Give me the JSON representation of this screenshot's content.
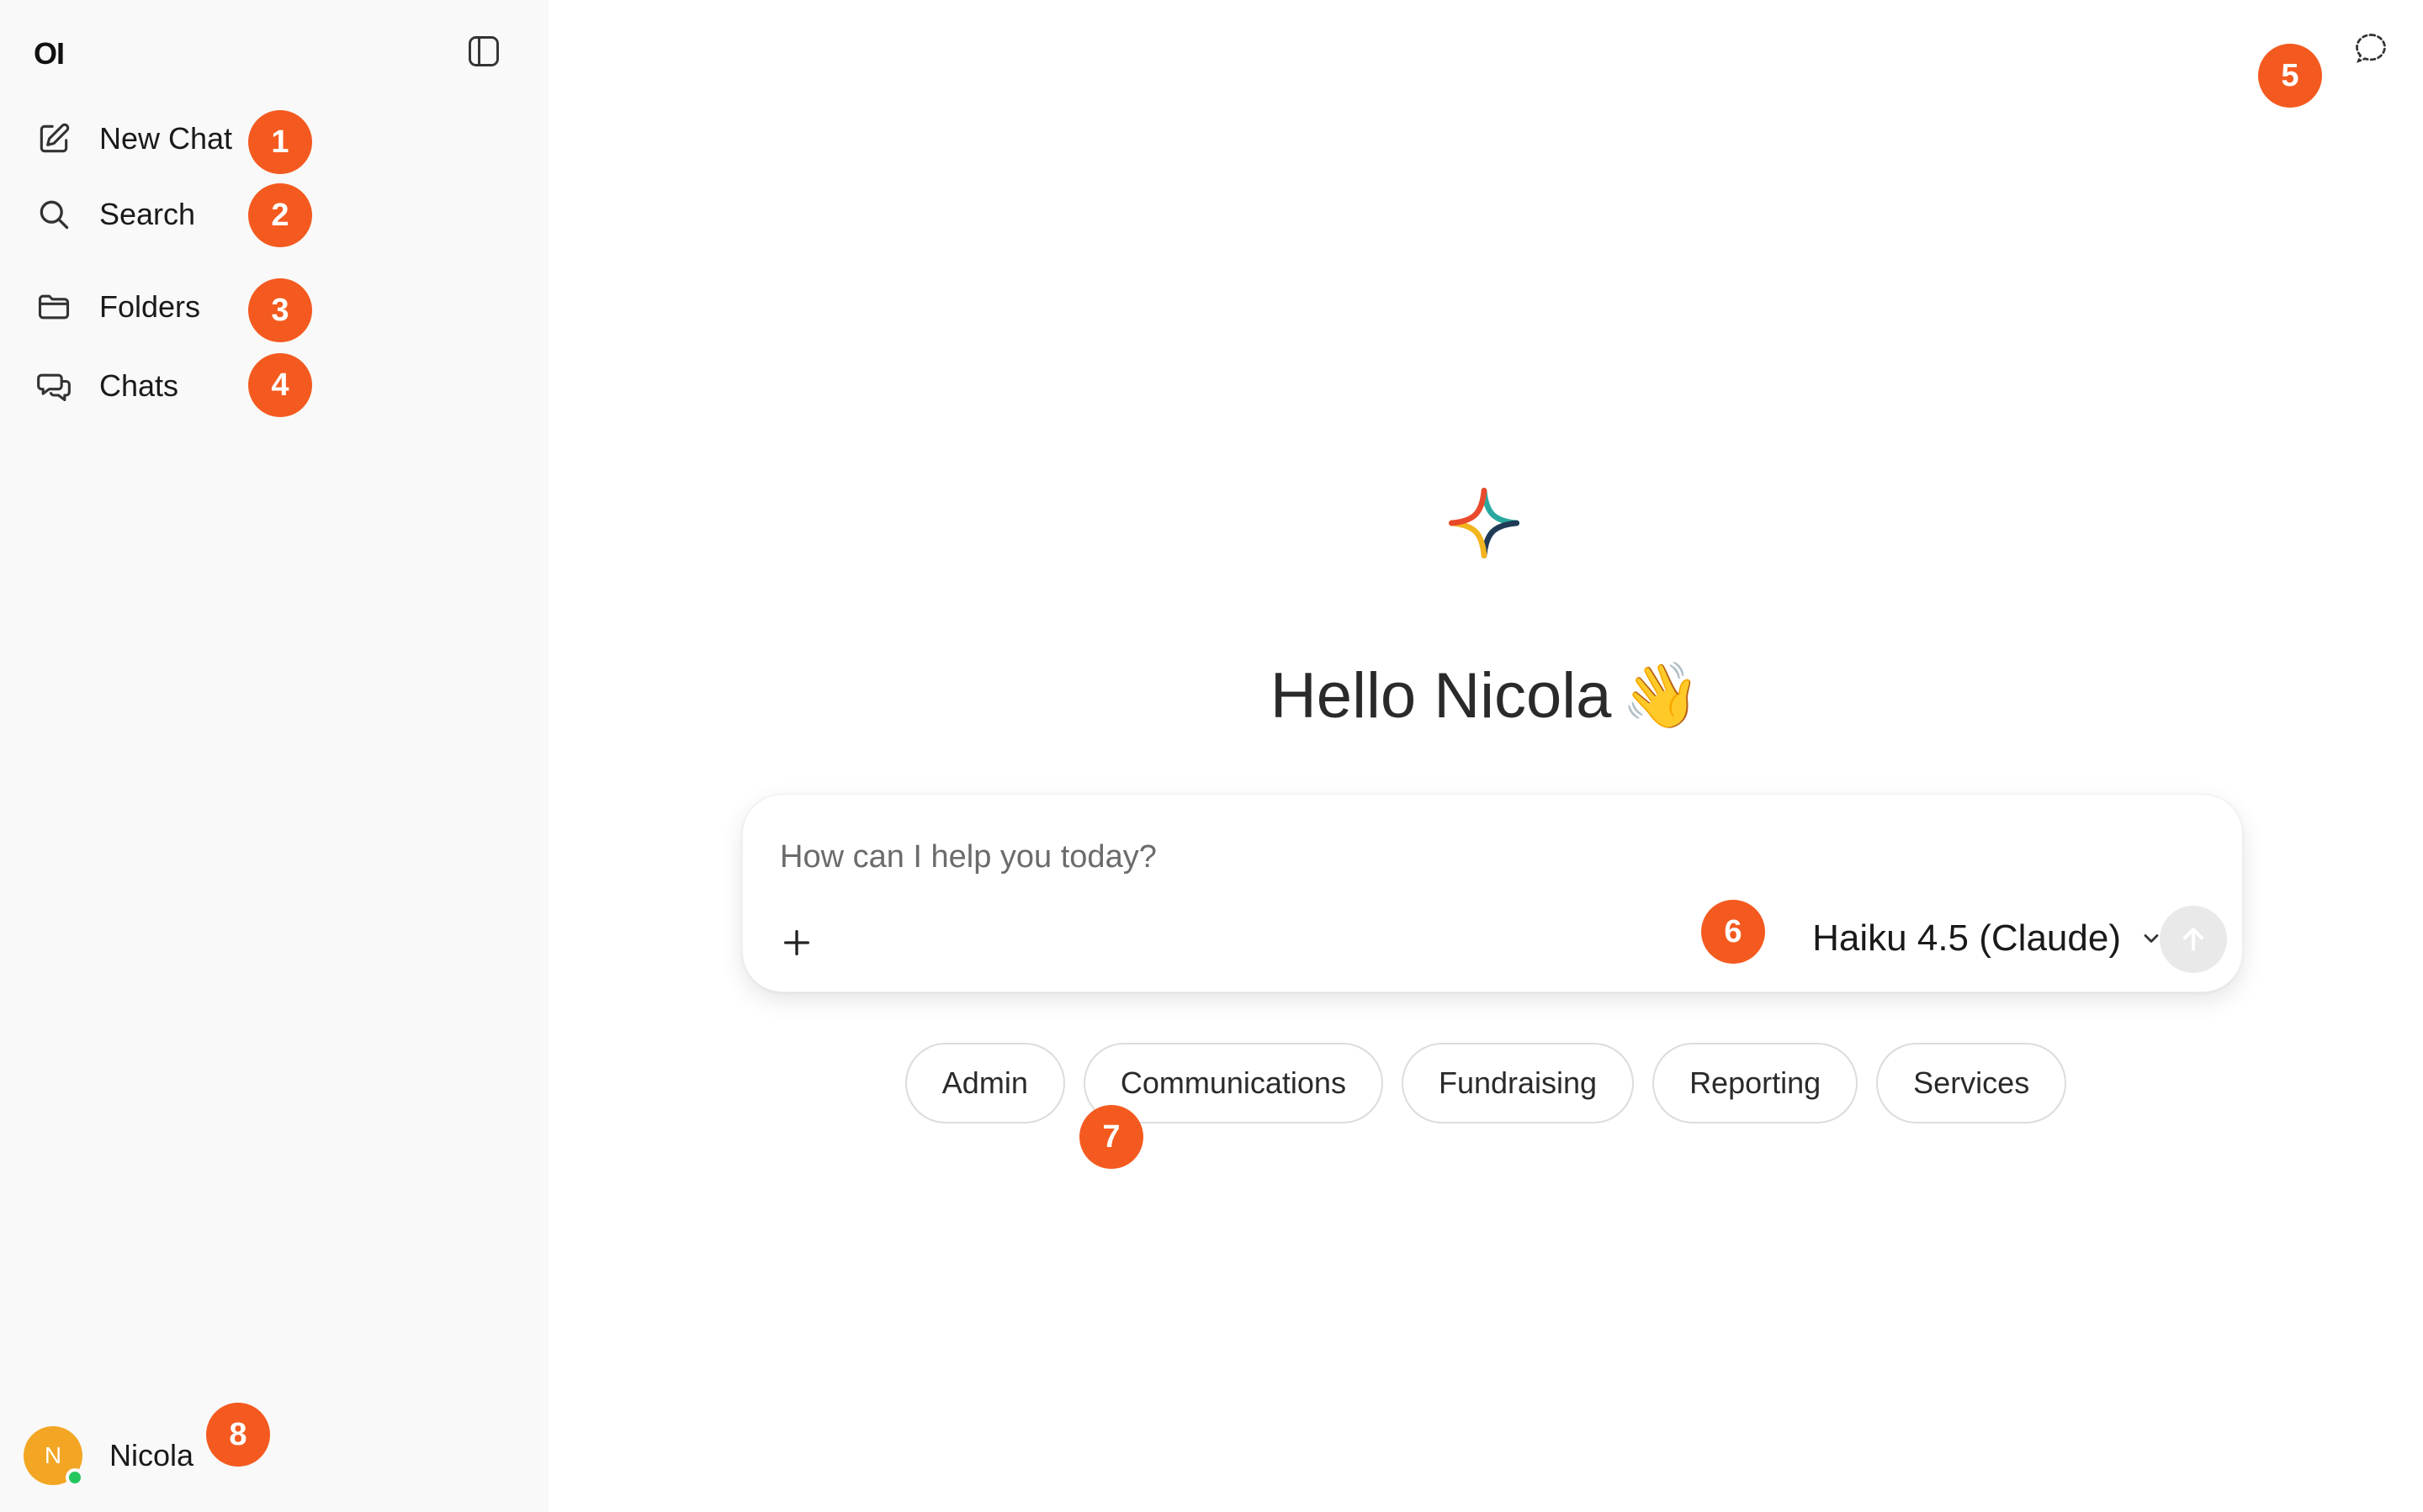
{
  "sidebar": {
    "logo": "OI",
    "items": [
      {
        "label": "New Chat",
        "icon": "pencil-square-icon"
      },
      {
        "label": "Search",
        "icon": "search-icon"
      },
      {
        "label": "Folders",
        "icon": "folder-icon"
      },
      {
        "label": "Chats",
        "icon": "chat-bubbles-icon"
      }
    ],
    "user": {
      "initial": "N",
      "name": "Nicola",
      "status_color": "#22c55e"
    }
  },
  "main": {
    "greeting": "Hello Nicola",
    "greeting_emoji": "👋",
    "composer": {
      "placeholder": "How can I help you today?",
      "model": "Haiku 4.5 (Claude)"
    },
    "suggestions": [
      "Admin",
      "Communications",
      "Fundraising",
      "Reporting",
      "Services"
    ]
  },
  "badges": [
    "1",
    "2",
    "3",
    "4",
    "5",
    "6",
    "7",
    "8"
  ],
  "colors": {
    "badge": "#f45a1f",
    "avatar": "#f3a623",
    "sidebar_bg": "#f9f9f9"
  }
}
